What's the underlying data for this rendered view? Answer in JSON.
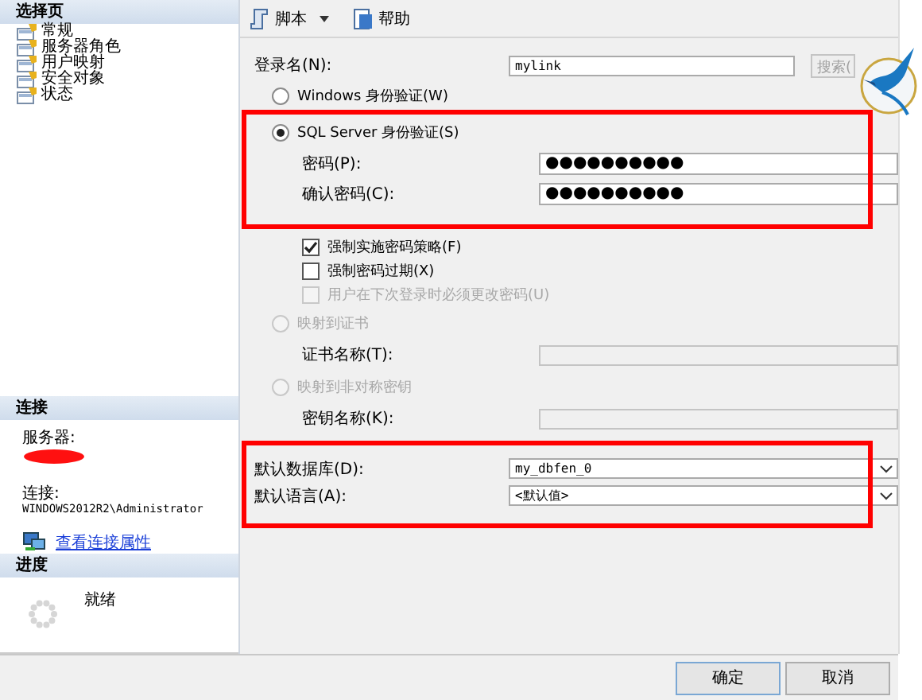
{
  "sidebar": {
    "title": "选择页",
    "items": [
      {
        "label": "常规"
      },
      {
        "label": "服务器角色"
      },
      {
        "label": "用户映射"
      },
      {
        "label": "安全对象"
      },
      {
        "label": "状态"
      }
    ]
  },
  "connection": {
    "title": "连接",
    "server_label": "服务器:",
    "connection_label": "连接:",
    "connection_value": "WINDOWS2012R2\\Administrator",
    "link": "查看连接属性"
  },
  "progress": {
    "title": "进度",
    "status": "就绪"
  },
  "toolbar": [
    {
      "kind": "dropdown",
      "label": "脚本"
    },
    {
      "kind": "button",
      "label": "帮助"
    }
  ],
  "groups": [
    {
      "highlighted": false,
      "rows": [
        {
          "kind": "text_field",
          "label": "登录名(N):",
          "value": "mylink",
          "button": "搜索(",
          "disabled": false
        },
        {
          "kind": "radio",
          "label": "Windows 身份验证(W)",
          "selected": false,
          "disabled": false
        }
      ]
    },
    {
      "highlighted": true,
      "rows": [
        {
          "kind": "radio",
          "label": "SQL Server 身份验证(S)",
          "selected": true,
          "disabled": false
        },
        {
          "kind": "password",
          "label": "密码(P):",
          "value": "●●●●●●●●●●",
          "disabled": false
        },
        {
          "kind": "password",
          "label": "确认密码(C):",
          "value": "●●●●●●●●●●",
          "disabled": false
        }
      ]
    },
    {
      "highlighted": false,
      "rows": [
        {
          "kind": "checkbox",
          "label": "强制实施密码策略(F)",
          "checked": true,
          "disabled": false
        },
        {
          "kind": "checkbox",
          "label": "强制密码过期(X)",
          "checked": false,
          "disabled": false
        },
        {
          "kind": "checkbox",
          "label": "用户在下次登录时必须更改密码(U)",
          "checked": false,
          "disabled": true
        },
        {
          "kind": "radio",
          "label": "映射到证书",
          "selected": false,
          "disabled": true
        },
        {
          "kind": "field",
          "label": "证书名称(T):",
          "disabled": true
        },
        {
          "kind": "radio",
          "label": "映射到非对称密钥",
          "selected": false,
          "disabled": true
        },
        {
          "kind": "field",
          "label": "密钥名称(K):",
          "disabled": true
        }
      ]
    },
    {
      "highlighted": true,
      "rows": [
        {
          "kind": "select",
          "label": "默认数据库(D):",
          "value": "my_dbfen_0",
          "disabled": false
        },
        {
          "kind": "select",
          "label": "默认语言(A):",
          "value": "<默认值>",
          "disabled": false
        }
      ]
    }
  ],
  "buttons": [
    {
      "label": "确定"
    },
    {
      "label": "取消"
    }
  ]
}
